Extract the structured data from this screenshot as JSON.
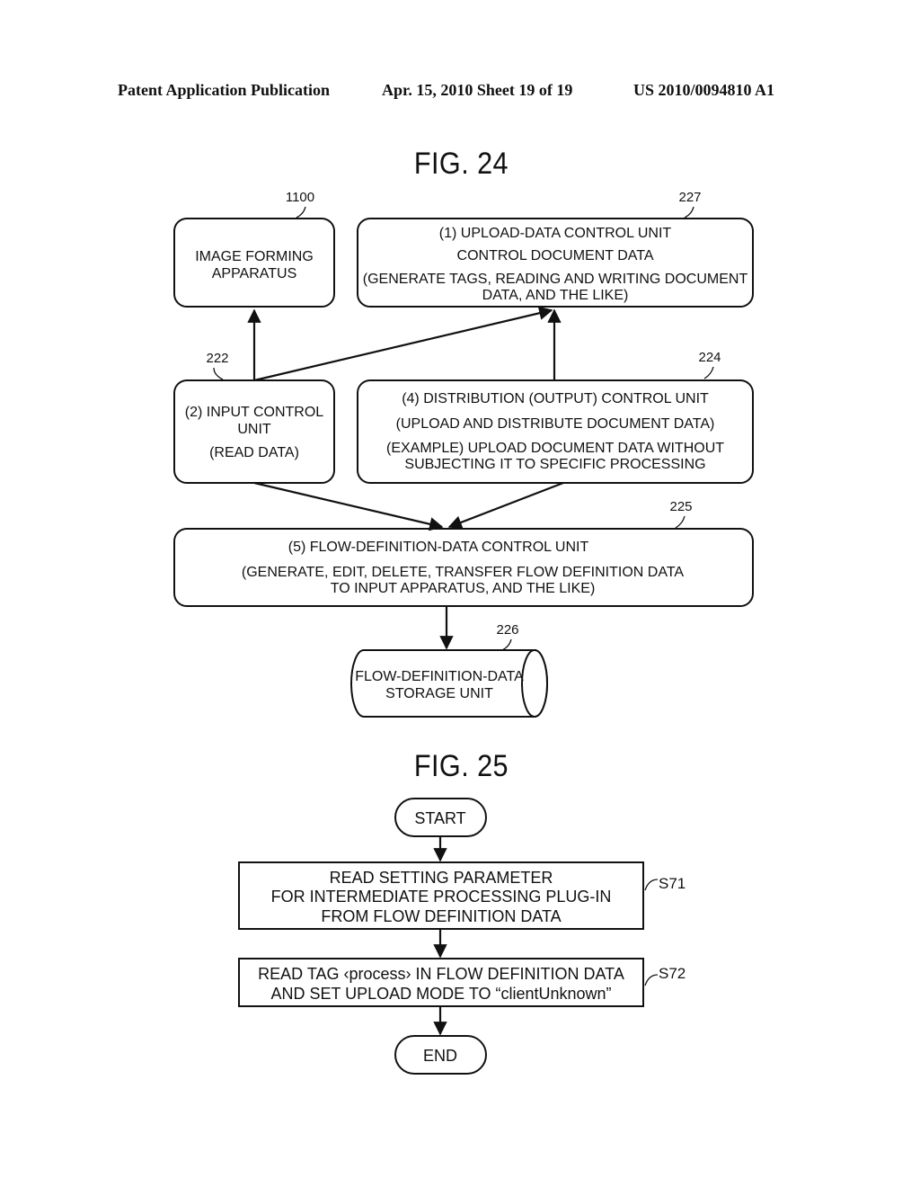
{
  "header": {
    "publication": "Patent Application Publication",
    "date_sheet": "Apr. 15, 2010  Sheet 19 of 19",
    "number": "US 2010/0094810 A1"
  },
  "fig24": {
    "title": "FIG. 24",
    "nodes": {
      "image_forming": {
        "ref": "1100",
        "lines": [
          "IMAGE FORMING",
          "APPARATUS"
        ]
      },
      "upload_data": {
        "ref": "227",
        "lines": [
          "(1) UPLOAD-DATA CONTROL UNIT",
          "CONTROL DOCUMENT DATA",
          "(GENERATE TAGS, READING AND WRITING DOCUMENT",
          "DATA, AND THE LIKE)"
        ]
      },
      "input_control": {
        "ref": "222",
        "lines": [
          "(2) INPUT CONTROL",
          "UNIT",
          "(READ DATA)"
        ]
      },
      "distribution": {
        "ref": "224",
        "lines": [
          "(4) DISTRIBUTION (OUTPUT) CONTROL UNIT",
          "(UPLOAD AND DISTRIBUTE DOCUMENT DATA)",
          "(EXAMPLE) UPLOAD DOCUMENT DATA WITHOUT",
          "SUBJECTING IT TO SPECIFIC PROCESSING"
        ]
      },
      "flow_def_control": {
        "ref": "225",
        "lines": [
          "(5) FLOW-DEFINITION-DATA CONTROL UNIT",
          "(GENERATE, EDIT, DELETE, TRANSFER FLOW DEFINITION DATA",
          "TO INPUT APPARATUS, AND THE LIKE)"
        ]
      },
      "storage": {
        "ref": "226",
        "lines": [
          "FLOW-DEFINITION-DATA",
          "STORAGE UNIT"
        ]
      }
    },
    "edges": [
      {
        "from": "input_control",
        "to": "image_forming"
      },
      {
        "from": "input_control",
        "to": "upload_data"
      },
      {
        "from": "distribution",
        "to": "upload_data"
      },
      {
        "from": "input_control",
        "to": "flow_def_control"
      },
      {
        "from": "distribution",
        "to": "flow_def_control"
      },
      {
        "from": "flow_def_control",
        "to": "storage"
      }
    ]
  },
  "fig25": {
    "title": "FIG. 25",
    "start": "START",
    "end": "END",
    "steps": [
      {
        "ref": "S71",
        "lines": [
          "READ SETTING PARAMETER",
          "FOR INTERMEDIATE PROCESSING PLUG-IN",
          "FROM FLOW DEFINITION DATA"
        ]
      },
      {
        "ref": "S72",
        "lines": [
          "READ TAG ‹process› IN FLOW DEFINITION DATA",
          "AND SET UPLOAD MODE TO “clientUnknown”"
        ]
      }
    ]
  }
}
